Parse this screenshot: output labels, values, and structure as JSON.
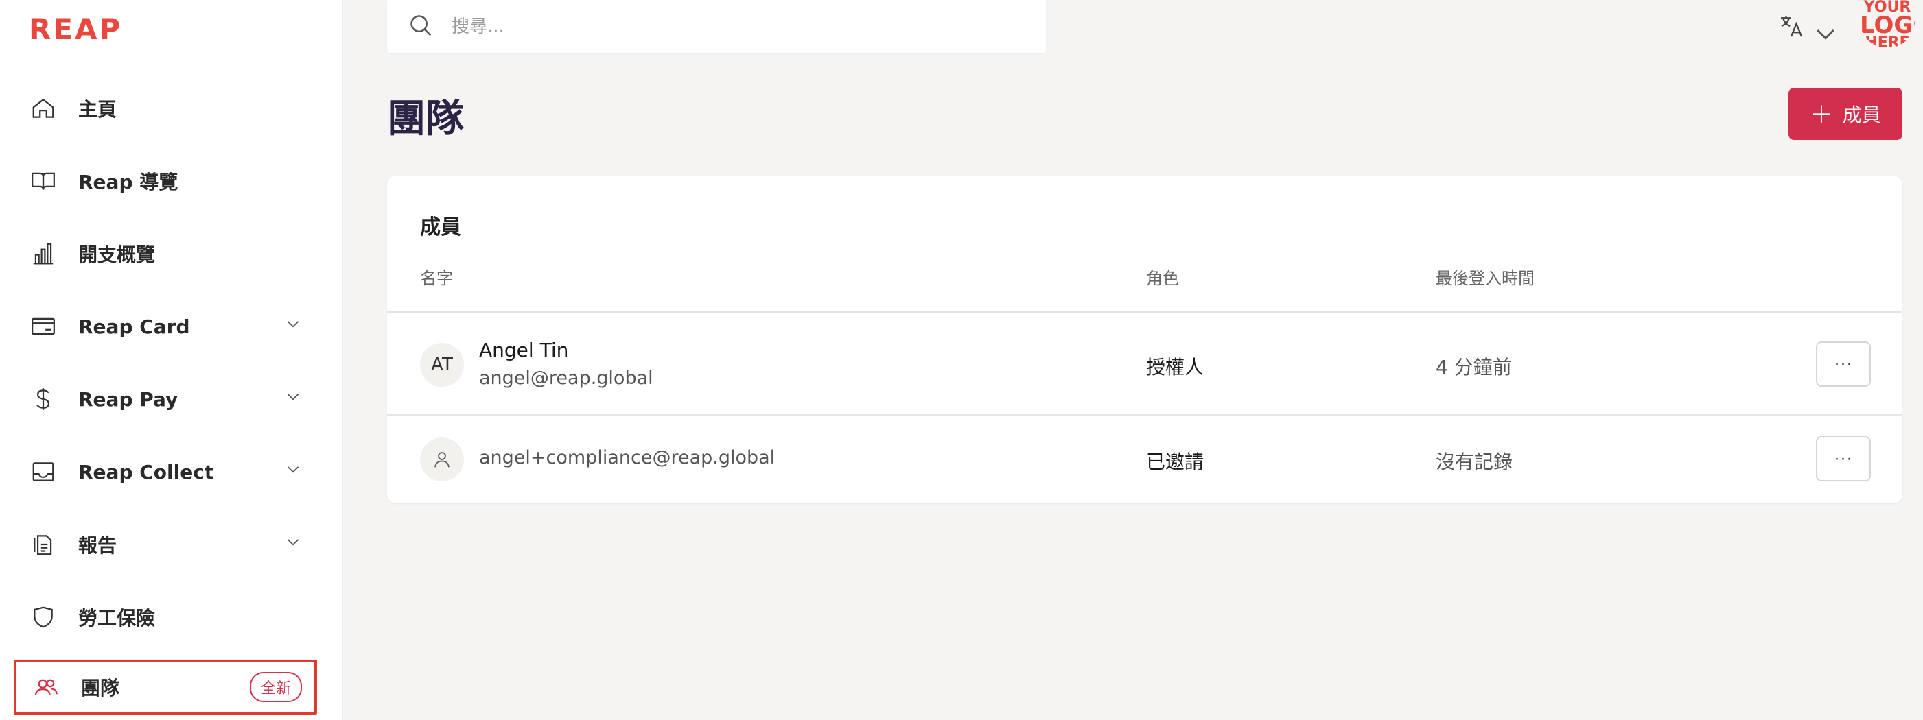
{
  "brand": {
    "logo_text": "REAP",
    "accent": "#e8483e",
    "primary": "#d22f4d"
  },
  "sidebar": {
    "items": [
      {
        "label": "主頁",
        "icon": "home-icon"
      },
      {
        "label": "Reap 導覽",
        "icon": "book-icon"
      },
      {
        "label": "開支概覽",
        "icon": "bar-chart-icon"
      },
      {
        "label": "Reap Card",
        "icon": "card-icon",
        "expandable": true
      },
      {
        "label": "Reap Pay",
        "icon": "dollar-icon",
        "expandable": true
      },
      {
        "label": "Reap Collect",
        "icon": "inbox-icon",
        "expandable": true
      },
      {
        "label": "報告",
        "icon": "document-icon",
        "expandable": true
      },
      {
        "label": "勞工保險",
        "icon": "shield-icon"
      },
      {
        "label": "團隊",
        "icon": "users-icon",
        "badge": "全新",
        "selected": true
      }
    ]
  },
  "header": {
    "search_placeholder": "搜尋...",
    "language_icon": "translate-icon",
    "logo_placeholder": {
      "line1": "YOUR",
      "line2": "LOGO",
      "line3": "HERE"
    }
  },
  "page": {
    "title": "團隊",
    "add_button_label": "成員"
  },
  "members": {
    "title": "成員",
    "columns": [
      "名字",
      "角色",
      "最後登入時間"
    ],
    "rows": [
      {
        "initials": "AT",
        "name": "Angel Tin",
        "email": "angel@reap.global",
        "role": "授權人",
        "last_login": "4 分鐘前",
        "more": "···"
      },
      {
        "initials": "",
        "name": "",
        "email": "angel+compliance@reap.global",
        "role": "已邀請",
        "last_login": "沒有記錄",
        "more": "···"
      }
    ]
  }
}
